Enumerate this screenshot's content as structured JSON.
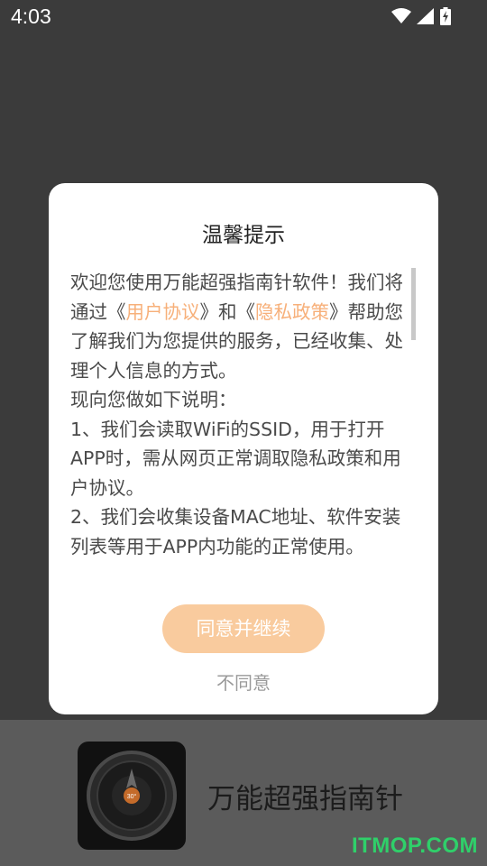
{
  "status_bar": {
    "time": "4:03",
    "icons": [
      "wifi-icon",
      "signal-icon",
      "battery-charging-icon"
    ]
  },
  "dialog": {
    "title": "温馨提示",
    "body": {
      "p1_a": "欢迎您使用万能超强指南针软件！我们将通过《",
      "link_user_agreement": "用户协议",
      "p1_b": "》和《",
      "link_privacy_policy": "隐私政策",
      "p1_c": "》帮助您了解我们为您提供的服务，已经收集、处理个人信息的方式。",
      "p2": "现向您做如下说明：",
      "p3": "1、我们会读取WiFi的SSID，用于打开APP时，需从网页正常调取隐私政策和用户协议。",
      "p4": "2、我们会收集设备MAC地址、软件安装列表等用于APP内功能的正常使用。"
    },
    "agree_label": "同意并继续",
    "disagree_label": "不同意"
  },
  "app_banner": {
    "app_name": "万能超强指南针",
    "compass_reading": "30°"
  },
  "watermark": "ITMOP.COM",
  "colors": {
    "overlay": "#3b3b3b",
    "link": "#f7b07a",
    "agree_button": "#f9cb9e",
    "watermark": "#2fd06a"
  }
}
